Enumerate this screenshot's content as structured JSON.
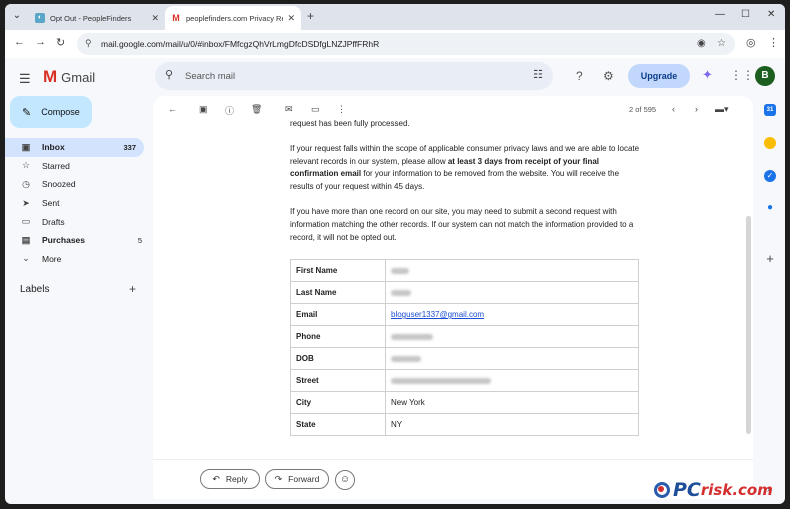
{
  "browser": {
    "tabs": [
      {
        "title": "Opt Out - PeopleFinders",
        "active": false,
        "favicon": "peoplefinders-favicon"
      },
      {
        "title": "peoplefinders.com Privacy Req",
        "active": true,
        "favicon": "gmail-favicon"
      }
    ],
    "url": "mail.google.com/mail/u/0/#inbox/FMfcgzQhVrLmgDfcDSDfgLNZJPffFRhR"
  },
  "gmail": {
    "app_name": "Gmail",
    "search_placeholder": "Search mail",
    "upgrade_label": "Upgrade",
    "avatar_letter": "B",
    "compose_label": "Compose",
    "nav": [
      {
        "label": "Inbox",
        "count": "337",
        "icon": "inbox-icon",
        "active": true
      },
      {
        "label": "Starred",
        "count": "",
        "icon": "star-icon",
        "active": false
      },
      {
        "label": "Snoozed",
        "count": "",
        "icon": "clock-icon",
        "active": false
      },
      {
        "label": "Sent",
        "count": "",
        "icon": "send-icon",
        "active": false
      },
      {
        "label": "Drafts",
        "count": "",
        "icon": "draft-icon",
        "active": false
      },
      {
        "label": "Purchases",
        "count": "5",
        "icon": "purchases-icon",
        "active": false,
        "bold": true
      },
      {
        "label": "More",
        "count": "",
        "icon": "chevron-down-icon",
        "active": false
      }
    ],
    "labels_heading": "Labels",
    "pager": "2 of 595"
  },
  "email": {
    "p1": "request has been fully processed.",
    "p2_a": "If your request falls within the scope of applicable consumer privacy laws and we are able to locate relevant records in our system, please allow ",
    "p2_b": "at least 3 days from receipt of your final confirmation email",
    "p2_c": " for your information to be removed from the website. You will receive the results of your request within 45 days.",
    "p3": "If you have more than one record on our site, you may need to submit a second request with information matching the other records. If our system can not match the information provided to a record, it will not be opted out.",
    "table": [
      {
        "key": "First Name",
        "value": "",
        "redacted": true
      },
      {
        "key": "Last Name",
        "value": "",
        "redacted": true
      },
      {
        "key": "Email",
        "value": "bloguser1337@gmail.com",
        "redacted": false,
        "link": true
      },
      {
        "key": "Phone",
        "value": "",
        "redacted": true
      },
      {
        "key": "DOB",
        "value": "",
        "redacted": true
      },
      {
        "key": "Street",
        "value": "",
        "redacted": true
      },
      {
        "key": "City",
        "value": "New York",
        "redacted": false
      },
      {
        "key": "State",
        "value": "NY",
        "redacted": false
      }
    ],
    "reply_label": "Reply",
    "forward_label": "Forward"
  },
  "watermark": {
    "pc": "PC",
    "risk": "risk.com"
  },
  "colors": {
    "accent": "#1a73e8",
    "compose_bg": "#c2e7ff",
    "nav_active_bg": "#d3e3fd",
    "upgrade_bg": "#c2d7fc",
    "gmail_red": "#d93025"
  }
}
